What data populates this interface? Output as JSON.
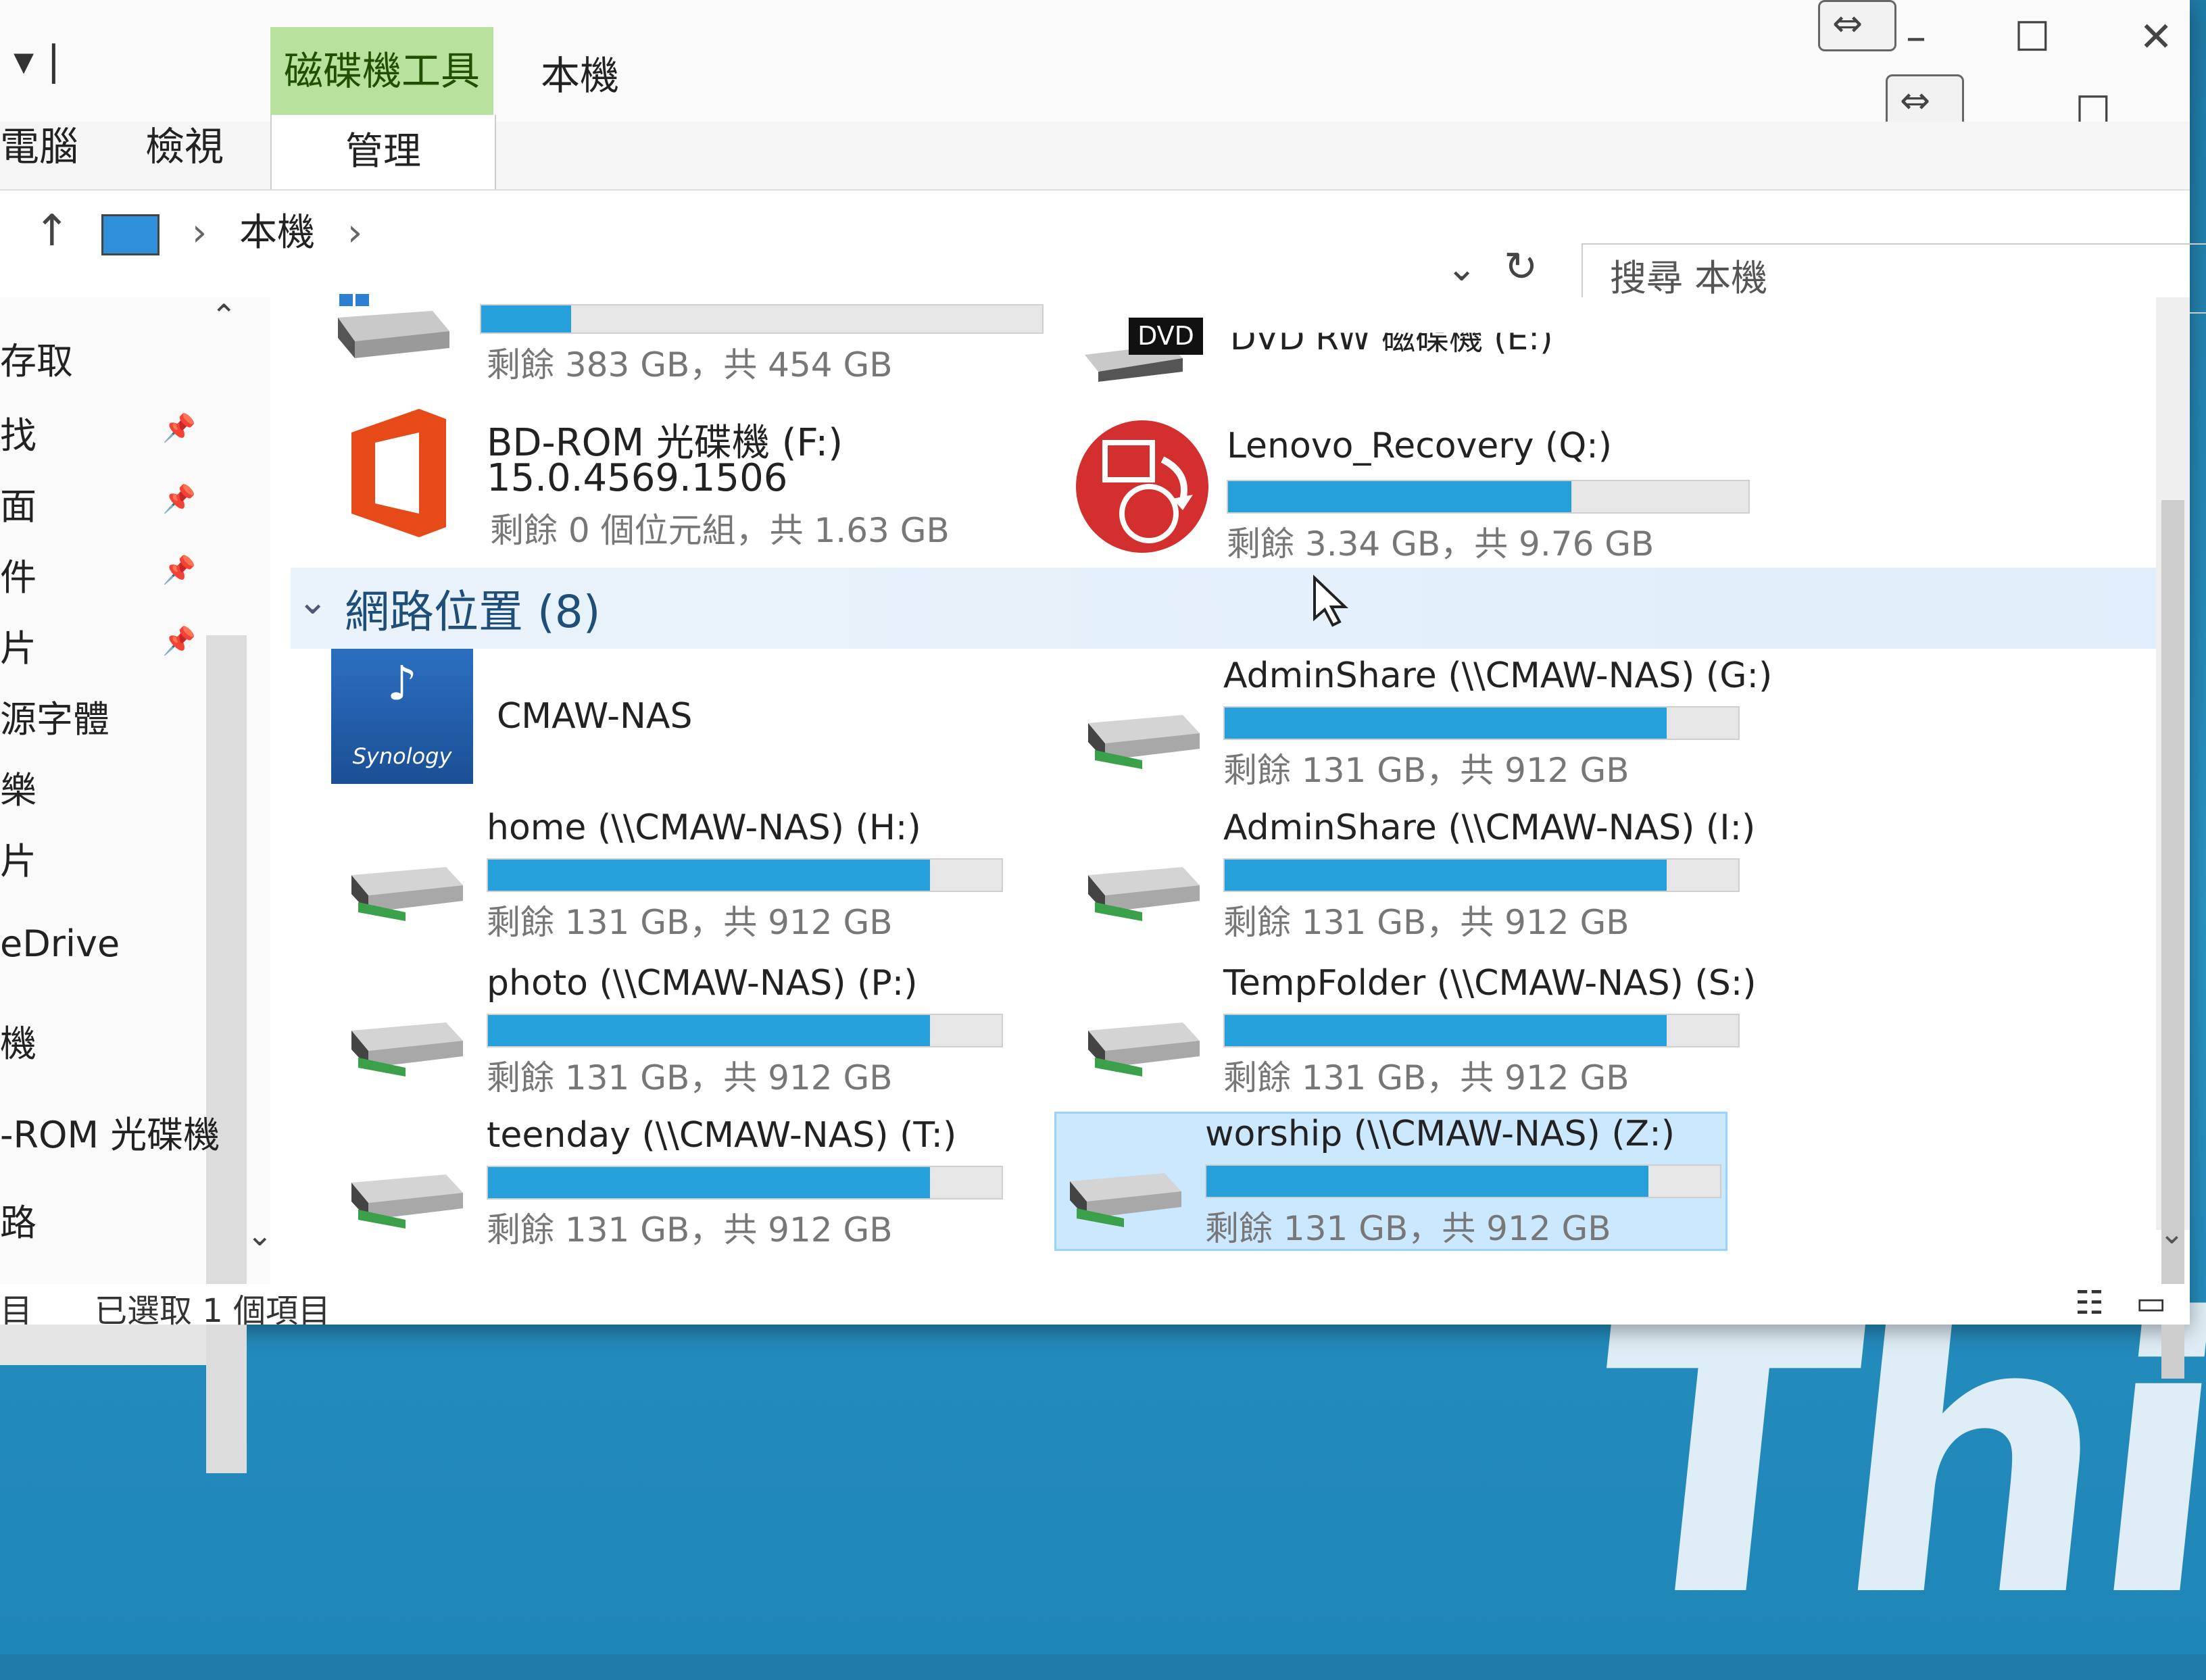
{
  "wallpaper_text": "Think",
  "title_bar": {
    "context_tab": "磁碟機工具",
    "title": "本機",
    "tab_left_partial": "電腦",
    "tab_view": "檢視",
    "tab_manage": "管理"
  },
  "address": {
    "path_item": "本機",
    "search_placeholder": "搜尋 本機"
  },
  "nav": {
    "items": [
      "存取",
      "找",
      "面",
      "件",
      "片",
      "源字體",
      "樂",
      "片",
      "eDrive",
      "機",
      "-ROM 光碟機",
      "路"
    ]
  },
  "group": {
    "label": "網路位置 (8)"
  },
  "drives_top": [
    {
      "name": "",
      "free_text": "剩餘 383 GB，共 454 GB",
      "used_fraction": 0.16
    },
    {
      "name": "BD-ROM 光碟機 (F:)",
      "line2": "15.0.4569.1506",
      "free_text": "剩餘 0 個位元組，共 1.63 GB"
    },
    {
      "name": "DVD RW 磁碟機 (E:)",
      "icon_label": "DVD"
    },
    {
      "name": "Lenovo_Recovery (Q:)",
      "free_text": "剩餘 3.34 GB，共 9.76 GB",
      "used_fraction": 0.66
    }
  ],
  "network": [
    {
      "name": "CMAW-NAS",
      "icon_label": "Synology"
    },
    {
      "name": "AdminShare (\\\\CMAW-NAS) (G:)",
      "free_text": "剩餘 131 GB，共 912 GB",
      "used_fraction": 0.86
    },
    {
      "name": "home (\\\\CMAW-NAS) (H:)",
      "free_text": "剩餘 131 GB，共 912 GB",
      "used_fraction": 0.86
    },
    {
      "name": "AdminShare (\\\\CMAW-NAS) (I:)",
      "free_text": "剩餘 131 GB，共 912 GB",
      "used_fraction": 0.86
    },
    {
      "name": "photo (\\\\CMAW-NAS) (P:)",
      "free_text": "剩餘 131 GB，共 912 GB",
      "used_fraction": 0.86
    },
    {
      "name": "TempFolder (\\\\CMAW-NAS) (S:)",
      "free_text": "剩餘 131 GB，共 912 GB",
      "used_fraction": 0.86
    },
    {
      "name": "teenday (\\\\CMAW-NAS) (T:)",
      "free_text": "剩餘 131 GB，共 912 GB",
      "used_fraction": 0.86
    },
    {
      "name": "worship (\\\\CMAW-NAS) (Z:)",
      "free_text": "剩餘 131 GB，共 912 GB",
      "used_fraction": 0.86
    }
  ],
  "status": {
    "items_partial": "目",
    "selected": "已選取 1 個項目"
  },
  "colors": {
    "bar_fill": "#26a0da",
    "context_tab": "#b7e19d",
    "selection": "#cce8ff"
  }
}
